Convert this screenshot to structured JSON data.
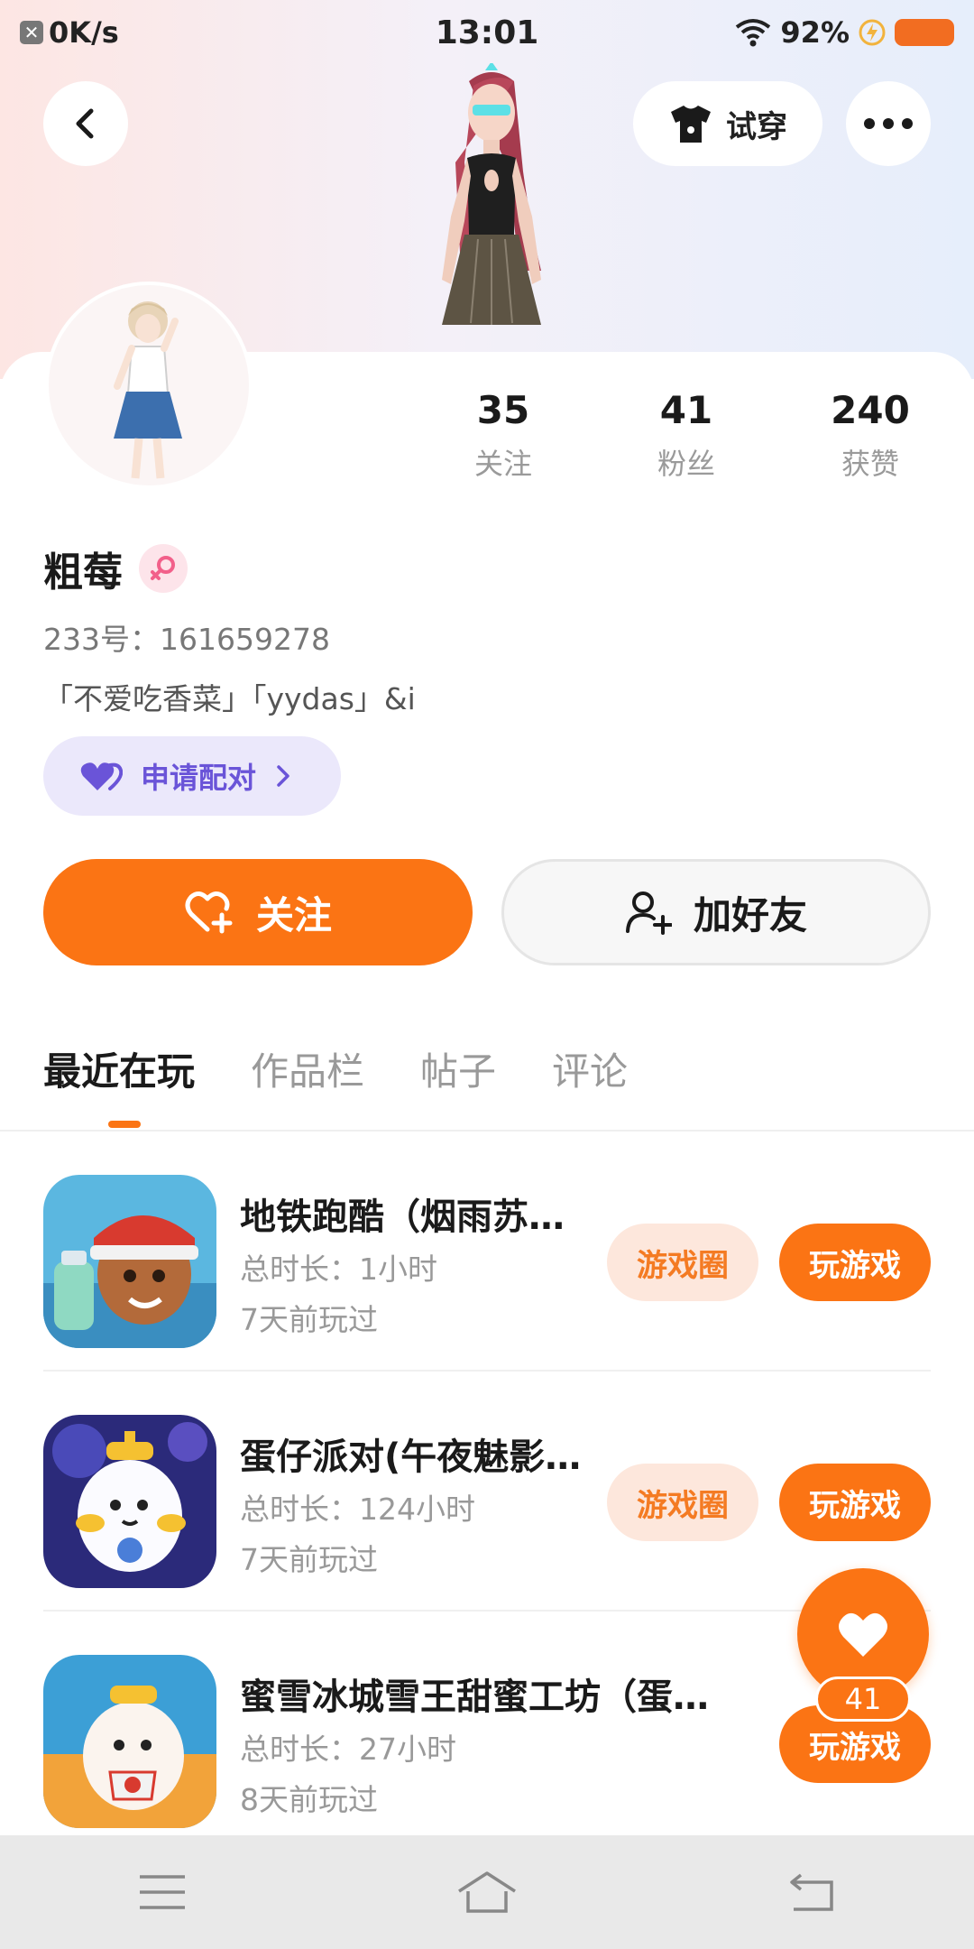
{
  "status_bar": {
    "net_speed": "0K/s",
    "time": "13:01",
    "battery": "92%"
  },
  "header": {
    "back_icon": "chevron-left-icon",
    "tryon_label": "试穿",
    "more_icon": "more-dots-icon"
  },
  "profile": {
    "name": "粗莓",
    "gender": "female",
    "uid": "233号：161659278",
    "bio": "「不爱吃香菜」「yydas」&i",
    "pair_label": "申请配对",
    "stats": [
      {
        "num": "35",
        "label": "关注"
      },
      {
        "num": "41",
        "label": "粉丝"
      },
      {
        "num": "240",
        "label": "获赞"
      }
    ]
  },
  "actions": {
    "follow_label": "关注",
    "add_friend_label": "加好友"
  },
  "tabs": [
    {
      "label": "最近在玩",
      "active": true
    },
    {
      "label": "作品栏",
      "active": false
    },
    {
      "label": "帖子",
      "active": false
    },
    {
      "label": "评论",
      "active": false
    }
  ],
  "games": [
    {
      "title": "地铁跑酷（烟雨苏…",
      "duration": "总时长：1小时",
      "last_played": "7天前玩过",
      "circle_label": "游戏圈",
      "play_label": "玩游戏"
    },
    {
      "title": "蛋仔派对(午夜魅影…",
      "duration": "总时长：124小时",
      "last_played": "7天前玩过",
      "circle_label": "游戏圈",
      "play_label": "玩游戏"
    },
    {
      "title": "蜜雪冰城雪王甜蜜工坊（蛋…",
      "duration": "总时长：27小时",
      "last_played": "8天前玩过",
      "play_label": "玩游戏"
    }
  ],
  "floating_like": {
    "count": "41"
  },
  "colors": {
    "accent": "#fb7414",
    "pair_bg": "#ebe8fb",
    "pair_text": "#6a54d8"
  }
}
